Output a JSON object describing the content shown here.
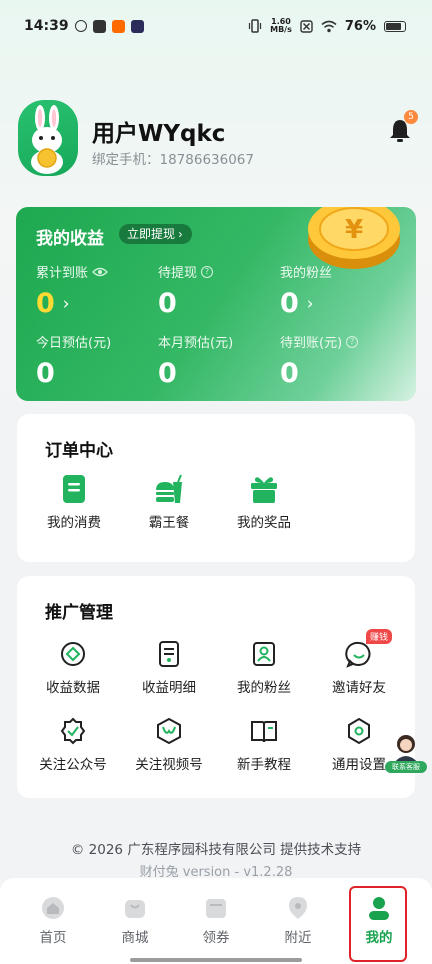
{
  "status_bar": {
    "time": "14:39",
    "net_speed_value": "1.60",
    "net_speed_unit": "MB/s",
    "battery": "76%"
  },
  "profile": {
    "username": "用户WYqkc",
    "phone_label": "绑定手机：18786636067",
    "notification_count": "5"
  },
  "earnings": {
    "title": "我的收益",
    "withdraw_button": "立即提现",
    "stats": [
      {
        "label": "累计到账",
        "value": "0"
      },
      {
        "label": "待提现",
        "value": "0"
      },
      {
        "label": "我的粉丝",
        "value": "0"
      },
      {
        "label": "今日预估(元)",
        "value": "0"
      },
      {
        "label": "本月预估(元)",
        "value": "0"
      },
      {
        "label": "待到账(元)",
        "value": "0"
      }
    ]
  },
  "orders": {
    "title": "订单中心",
    "items": [
      {
        "label": "我的消费",
        "icon": "receipt-icon"
      },
      {
        "label": "霸王餐",
        "icon": "burger-drink-icon"
      },
      {
        "label": "我的奖品",
        "icon": "gift-icon"
      }
    ]
  },
  "promotion": {
    "title": "推广管理",
    "items": [
      {
        "label": "收益数据",
        "icon": "diamond-data-icon"
      },
      {
        "label": "收益明细",
        "icon": "document-list-icon"
      },
      {
        "label": "我的粉丝",
        "icon": "fans-portrait-icon"
      },
      {
        "label": "邀请好友",
        "icon": "chat-invite-icon",
        "tag": "赚钱"
      },
      {
        "label": "关注公众号",
        "icon": "badge-check-icon"
      },
      {
        "label": "关注视频号",
        "icon": "video-channel-icon"
      },
      {
        "label": "新手教程",
        "icon": "book-icon"
      },
      {
        "label": "通用设置",
        "icon": "settings-icon"
      }
    ]
  },
  "customer_service": {
    "label": "联系客服"
  },
  "footer": {
    "copyright": "© 2026 广东程序园科技有限公司 提供技术支持",
    "version": "财付兔 version - v1.2.28"
  },
  "tabbar": {
    "items": [
      {
        "label": "首页"
      },
      {
        "label": "商城"
      },
      {
        "label": "领券"
      },
      {
        "label": "附近"
      },
      {
        "label": "我的"
      }
    ],
    "active_index": 4
  },
  "colors": {
    "brand_green": "#1aa34f",
    "highlight_red": "#e0232a",
    "value_gold": "#ffd934"
  }
}
